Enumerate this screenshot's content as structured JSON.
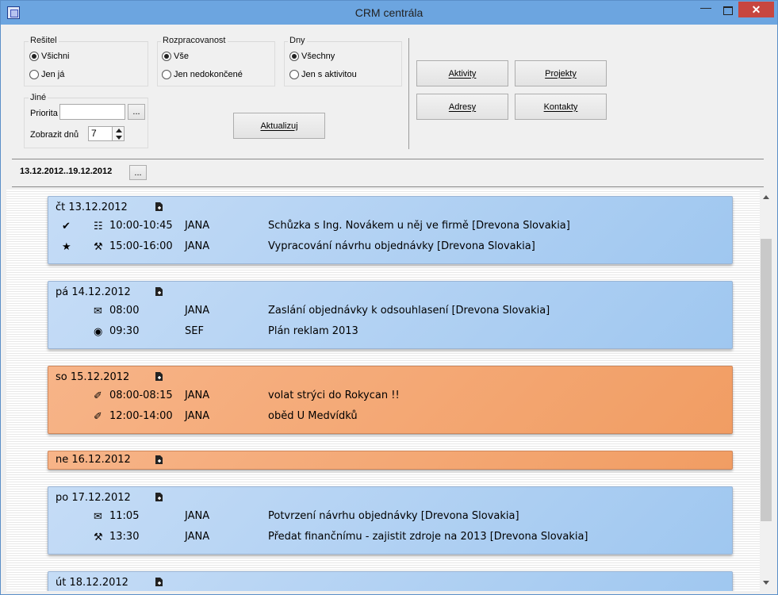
{
  "window": {
    "title": "CRM centrála"
  },
  "filters": {
    "resitel": {
      "label": "Rešitel",
      "options": [
        "Všichni",
        "Jen já"
      ],
      "selected": 0
    },
    "rozpracovanost": {
      "label": "Rozpracovanost",
      "options": [
        "Vše",
        "Jen nedokončené"
      ],
      "selected": 0
    },
    "dny": {
      "label": "Dny",
      "options": [
        "Všechny",
        "Jen s aktivitou"
      ],
      "selected": 0
    },
    "jine": {
      "label": "Jiné",
      "priorita_label": "Priorita",
      "priorita_value": "",
      "browse": "...",
      "zobrazit_label": "Zobrazit dnů",
      "zobrazit_value": "7"
    }
  },
  "buttons": {
    "refresh": "Aktualizuj",
    "aktivity": "Aktivity",
    "projekty": "Projekty",
    "adresy": "Adresy",
    "kontakty": "Kontakty"
  },
  "range": {
    "text": "13.12.2012..19.12.2012",
    "browse": "..."
  },
  "days": [
    {
      "date": "čt 13.12.2012",
      "color": "#b3d2f3",
      "items": [
        {
          "status": "check-icon",
          "type": "meeting-icon",
          "time": "10:00-10:45",
          "who": "JANA",
          "text": "Schůzka s Ing. Novákem u něj ve firmě [Drevona Slovakia]"
        },
        {
          "status": "star-icon",
          "type": "hammer-icon",
          "time": "15:00-16:00",
          "who": "JANA",
          "text": "Vypracování návrhu  objednávky [Drevona Slovakia]"
        }
      ]
    },
    {
      "date": "pá 14.12.2012",
      "color": "#b3d2f3",
      "items": [
        {
          "status": "",
          "type": "mail-icon",
          "time": "08:00",
          "who": "JANA",
          "text": "Zaslání objednávky k odsouhlasení [Drevona Slovakia]"
        },
        {
          "status": "",
          "type": "camera-icon",
          "time": "09:30",
          "who": "SEF",
          "text": "Plán reklam  2013"
        }
      ]
    },
    {
      "date": "so 15.12.2012",
      "color": "#f4a874",
      "items": [
        {
          "status": "",
          "type": "paperclip-icon",
          "time": "08:00-08:15",
          "who": "JANA",
          "text": "volat  strýci do Rokycan !!"
        },
        {
          "status": "",
          "type": "paperclip-icon",
          "time": "12:00-14:00",
          "who": "JANA",
          "text": "oběd  U Medvídků"
        }
      ]
    },
    {
      "date": "ne 16.12.2012",
      "color": "#f4a874",
      "items": []
    },
    {
      "date": "po 17.12.2012",
      "color": "#b3d2f3",
      "items": [
        {
          "status": "",
          "type": "mail-icon",
          "time": "11:05",
          "who": "JANA",
          "text": "Potvrzení návrhu objednávky [Drevona Slovakia]"
        },
        {
          "status": "",
          "type": "hammer-icon",
          "time": "13:30",
          "who": "JANA",
          "text": "Předat finančnímu - zajistit zdroje na 2013 [Drevona Slovakia]"
        }
      ]
    },
    {
      "date": "út 18.12.2012",
      "color": "#b3d2f3",
      "items": []
    }
  ]
}
